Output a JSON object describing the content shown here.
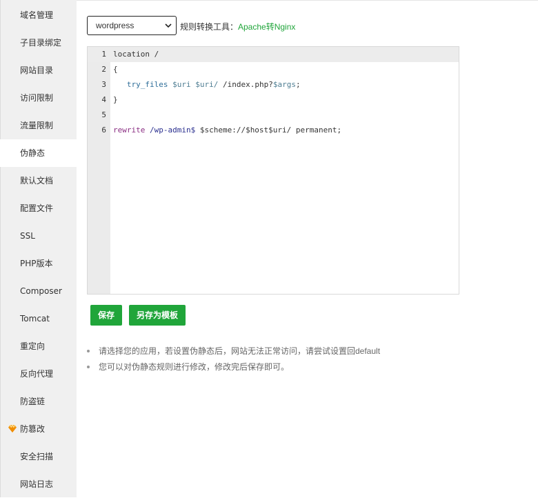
{
  "sidebar": {
    "items": [
      {
        "label": "域名管理"
      },
      {
        "label": "子目录绑定"
      },
      {
        "label": "网站目录"
      },
      {
        "label": "访问限制"
      },
      {
        "label": "流量限制"
      },
      {
        "label": "伪静态",
        "active": true
      },
      {
        "label": "默认文档"
      },
      {
        "label": "配置文件"
      },
      {
        "label": "SSL"
      },
      {
        "label": "PHP版本"
      },
      {
        "label": "Composer"
      },
      {
        "label": "Tomcat"
      },
      {
        "label": "重定向"
      },
      {
        "label": "反向代理"
      },
      {
        "label": "防盗链"
      },
      {
        "label": "防篡改",
        "icon": "gem-icon"
      },
      {
        "label": "安全扫描"
      },
      {
        "label": "网站日志"
      }
    ]
  },
  "toolbar": {
    "template_select_value": "wordpress",
    "tool_label": "规则转换工具：",
    "tool_link": "Apache转Nginx"
  },
  "editor": {
    "line_numbers": [
      "1",
      "2",
      "3",
      "4",
      "5",
      "6"
    ],
    "lines": [
      "location /",
      "{",
      "   try_files $uri $uri/ /index.php?$args;",
      "}",
      "",
      "rewrite /wp-admin$ $scheme://$host$uri/ permanent;"
    ]
  },
  "buttons": {
    "save_label": "保存",
    "save_as_template_label": "另存为模板"
  },
  "tips": [
    "请选择您的应用，若设置伪静态后，网站无法正常访问，请尝试设置回default",
    "您可以对伪静态规则进行修改，修改完后保存即可。"
  ],
  "colors": {
    "accent": "#20a53a",
    "sidebar_bg": "#f0f0f0",
    "gem": "#f5a623"
  }
}
